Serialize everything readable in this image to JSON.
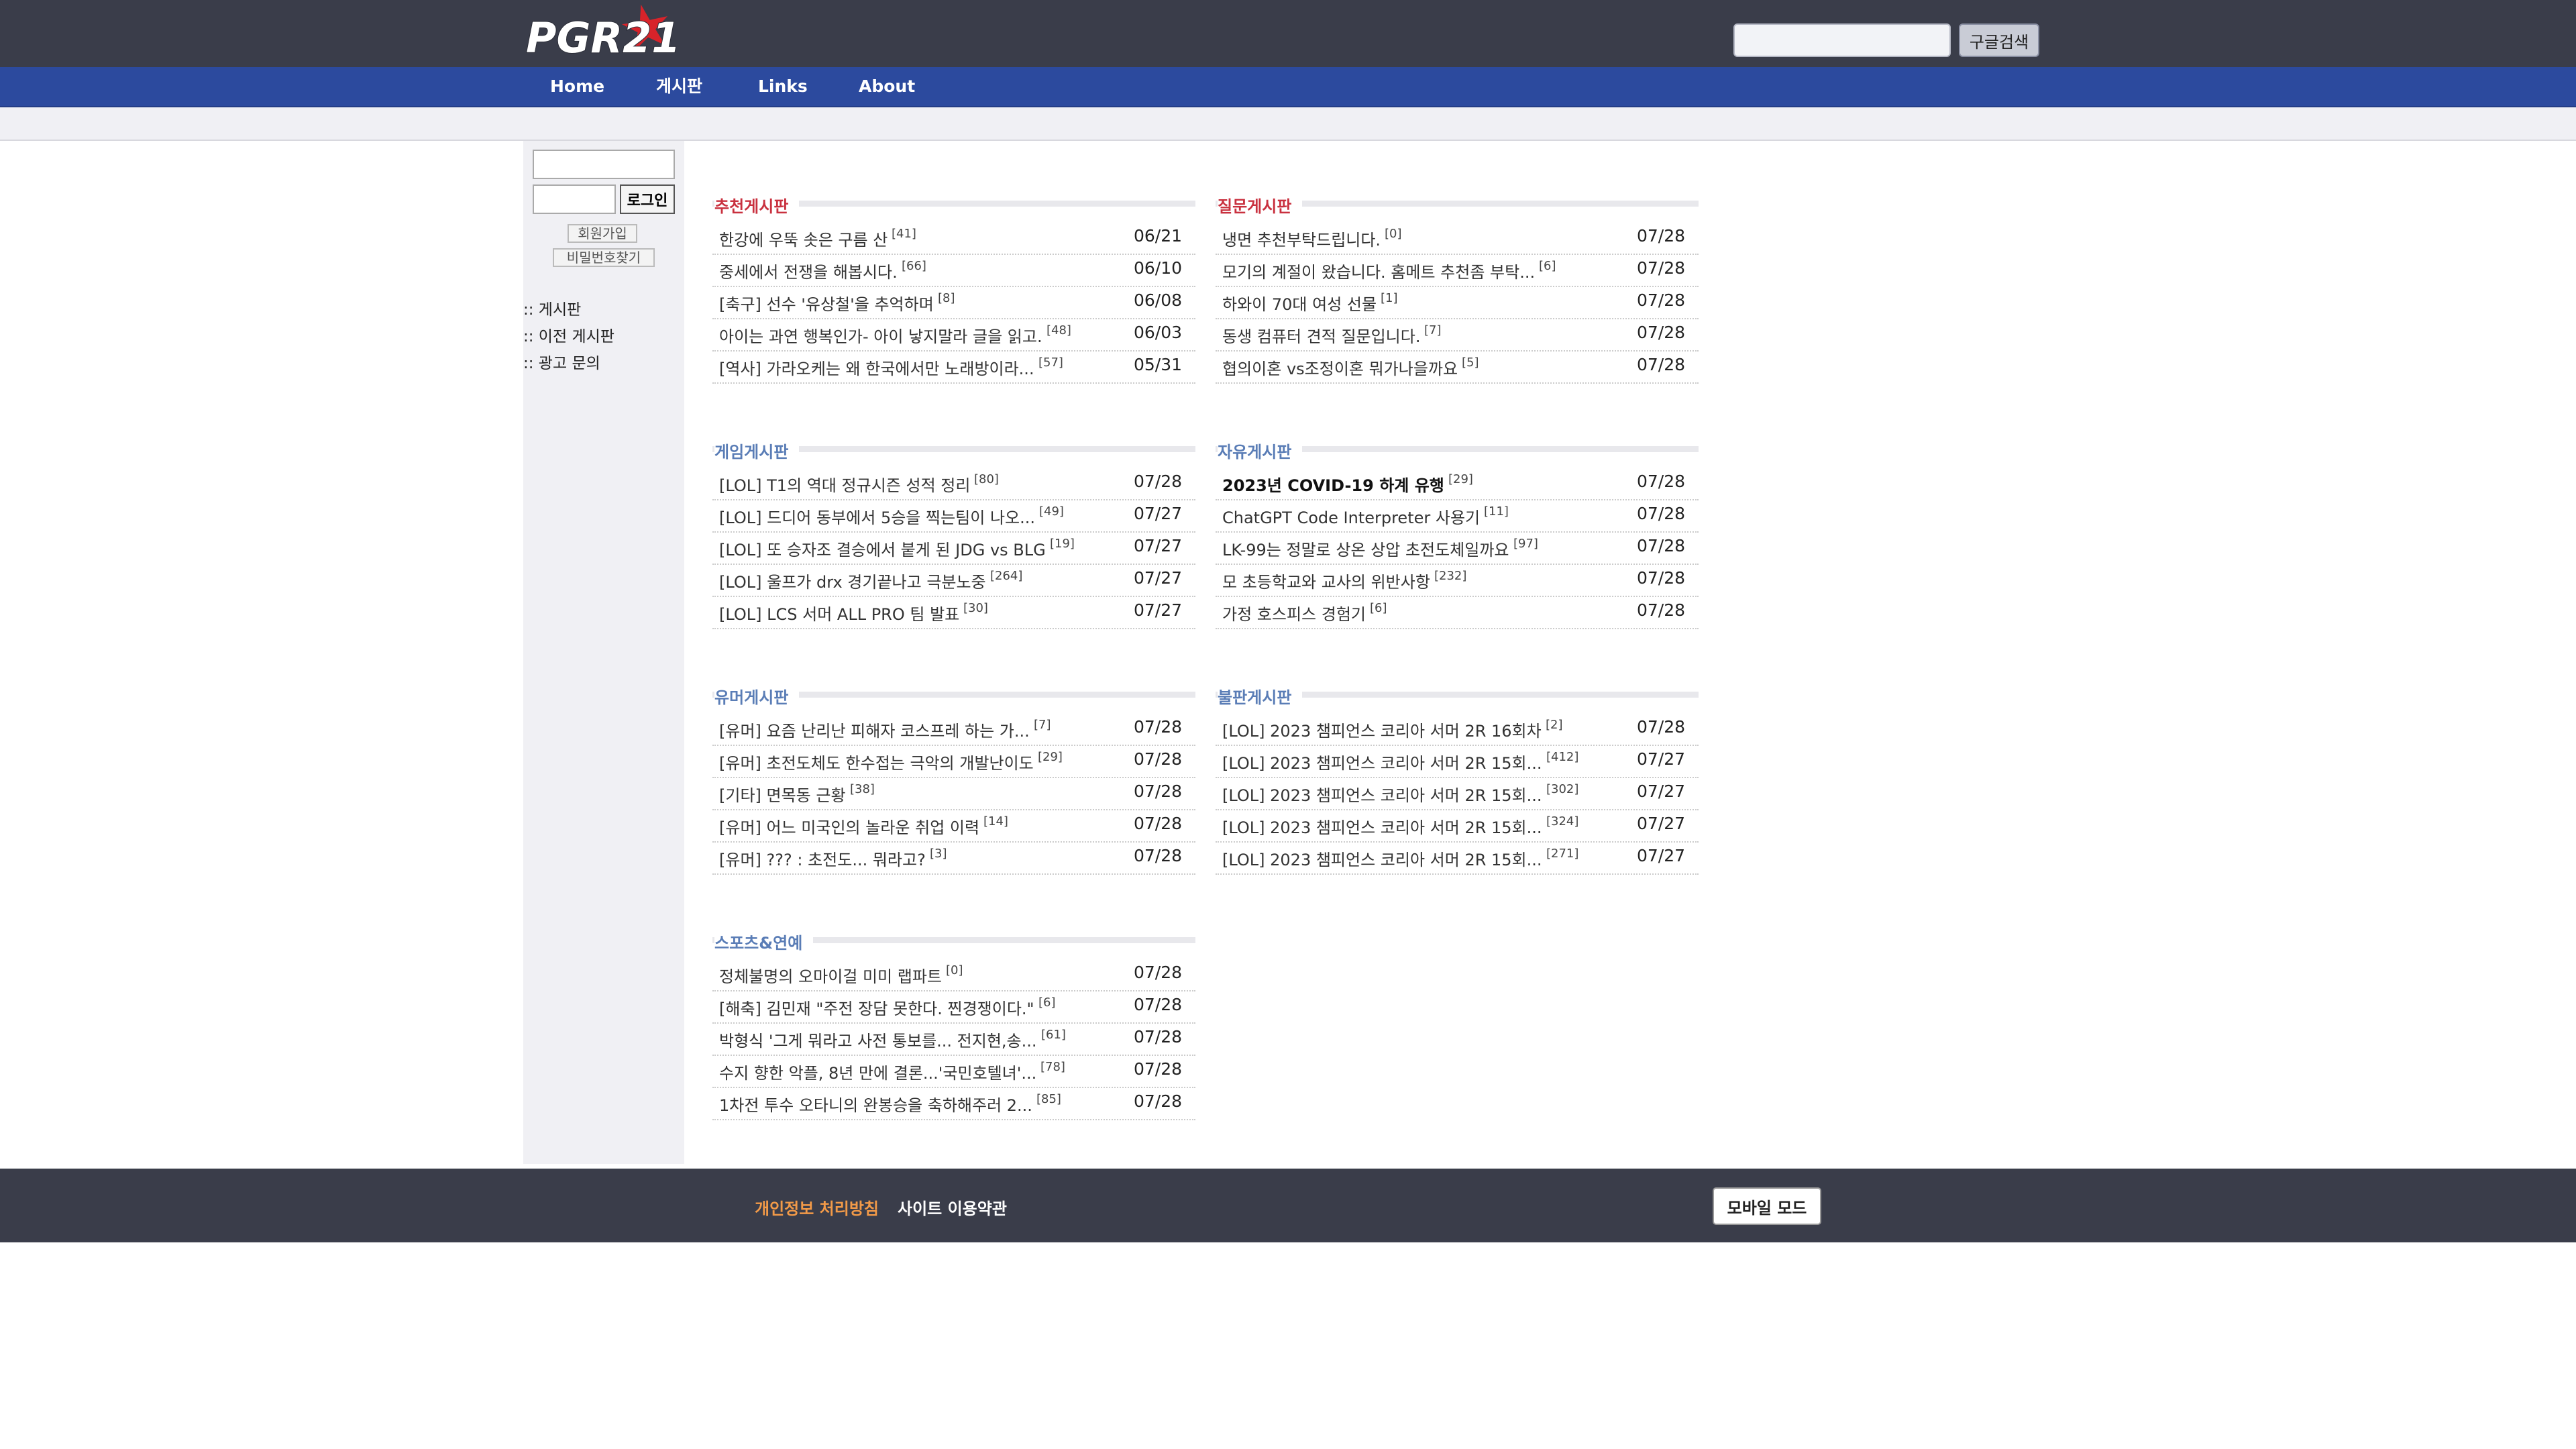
{
  "header": {
    "logo_text": "PGR21",
    "search_placeholder": "",
    "search_button": "구글검색"
  },
  "nav": {
    "items": [
      {
        "label": "Home"
      },
      {
        "label": "게시판"
      },
      {
        "label": "Links"
      },
      {
        "label": "About"
      }
    ]
  },
  "sidebar": {
    "login_button": "로그인",
    "signup_button": "회원가입",
    "find_password_button": "비밀번호찾기",
    "links": [
      {
        "label": ":: 게시판"
      },
      {
        "label": ":: 이전 게시판"
      },
      {
        "label": ":: 광고 문의"
      }
    ]
  },
  "boards": [
    {
      "title": "추천게시판",
      "title_color": "#c9313f",
      "posts": [
        {
          "title": "한강에 우뚝 솟은 구름 산",
          "count": "[41]",
          "date": "06/21"
        },
        {
          "title": "중세에서 전쟁을 해봅시다.",
          "count": "[66]",
          "date": "06/10"
        },
        {
          "title": "[축구] 선수 '유상철'을 추억하며",
          "count": "[8]",
          "date": "06/08"
        },
        {
          "title": "아이는 과연 행복인가- 아이 낳지말라 글을 읽고.",
          "count": "[48]",
          "date": "06/03"
        },
        {
          "title": "[역사] 가라오케는 왜 한국에서만 노래방이라...",
          "count": "[57]",
          "date": "05/31"
        }
      ]
    },
    {
      "title": "질문게시판",
      "title_color": "#c9313f",
      "posts": [
        {
          "title": "냉면 추천부탁드립니다.",
          "count": "[0]",
          "date": "07/28"
        },
        {
          "title": "모기의 계절이 왔습니다. 홈메트 추천좀 부탁...",
          "count": "[6]",
          "date": "07/28"
        },
        {
          "title": "하와이 70대 여성 선물",
          "count": "[1]",
          "date": "07/28"
        },
        {
          "title": "동생 컴퓨터 견적 질문입니다.",
          "count": "[7]",
          "date": "07/28"
        },
        {
          "title": "협의이혼 vs조정이혼 뭐가나을까요",
          "count": "[5]",
          "date": "07/28"
        }
      ]
    },
    {
      "title": "게임게시판",
      "title_color": "#5a7db6",
      "posts": [
        {
          "title": "[LOL] T1의 역대 정규시즌 성적 정리",
          "count": "[80]",
          "date": "07/28"
        },
        {
          "title": "[LOL] 드디어 동부에서 5승을 찍는팀이 나오...",
          "count": "[49]",
          "date": "07/27"
        },
        {
          "title": "[LOL] 또 승자조 결승에서 붙게 된 JDG vs BLG",
          "count": "[19]",
          "date": "07/27"
        },
        {
          "title": "[LOL] 울프가 drx 경기끝나고 극분노중",
          "count": "[264]",
          "date": "07/27"
        },
        {
          "title": "[LOL] LCS 서머 ALL PRO 팀 발표",
          "count": "[30]",
          "date": "07/27"
        }
      ]
    },
    {
      "title": "자유게시판",
      "title_color": "#5a7db6",
      "posts": [
        {
          "title": "2023년 COVID-19 하계 유행",
          "count": "[29]",
          "date": "07/28",
          "bold": true
        },
        {
          "title": "ChatGPT Code Interpreter 사용기",
          "count": "[11]",
          "date": "07/28"
        },
        {
          "title": "LK-99는 정말로 상온 상압 초전도체일까요",
          "count": "[97]",
          "date": "07/28"
        },
        {
          "title": "모 초등학교와 교사의 위반사항",
          "count": "[232]",
          "date": "07/28"
        },
        {
          "title": "가정 호스피스 경험기",
          "count": "[6]",
          "date": "07/28"
        }
      ]
    },
    {
      "title": "유머게시판",
      "title_color": "#5a7db6",
      "posts": [
        {
          "title": "[유머] 요즘 난리난 피해자 코스프레 하는 가...",
          "count": "[7]",
          "date": "07/28"
        },
        {
          "title": "[유머] 초전도체도 한수접는 극악의 개발난이도",
          "count": "[29]",
          "date": "07/28"
        },
        {
          "title": "[기타] 면목동 근황",
          "count": "[38]",
          "date": "07/28"
        },
        {
          "title": "[유머] 어느 미국인의 놀라운 취업 이력",
          "count": "[14]",
          "date": "07/28"
        },
        {
          "title": "[유머] ??? : 초전도... 뭐라고?",
          "count": "[3]",
          "date": "07/28"
        }
      ]
    },
    {
      "title": "불판게시판",
      "title_color": "#5a7db6",
      "posts": [
        {
          "title": "[LOL] 2023 챔피언스 코리아 서머 2R 16회차",
          "count": "[2]",
          "date": "07/28"
        },
        {
          "title": "[LOL] 2023 챔피언스 코리아 서머 2R 15회...",
          "count": "[412]",
          "date": "07/27"
        },
        {
          "title": "[LOL] 2023 챔피언스 코리아 서머 2R 15회...",
          "count": "[302]",
          "date": "07/27"
        },
        {
          "title": "[LOL] 2023 챔피언스 코리아 서머 2R 15회...",
          "count": "[324]",
          "date": "07/27"
        },
        {
          "title": "[LOL] 2023 챔피언스 코리아 서머 2R 15회...",
          "count": "[271]",
          "date": "07/27"
        }
      ]
    },
    {
      "title": "스포츠&연예",
      "title_color": "#5a7db6",
      "posts": [
        {
          "title": "정체불명의 오마이걸 미미 랩파트",
          "count": "[0]",
          "date": "07/28"
        },
        {
          "title": "[해축] 김민재 \"주전 장담 못한다. 찐경쟁이다.\"",
          "count": "[6]",
          "date": "07/28"
        },
        {
          "title": "박형식 '그게 뭐라고 사전 통보를... 전지현,송...",
          "count": "[61]",
          "date": "07/28"
        },
        {
          "title": "수지 향한 악플, 8년 만에 결론...'국민호텔녀'...",
          "count": "[78]",
          "date": "07/28"
        },
        {
          "title": "1차전 투수 오타니의 완봉승을 축하해주러 2...",
          "count": "[85]",
          "date": "07/28"
        }
      ]
    }
  ],
  "footer": {
    "privacy_label": "개인정보 처리방침",
    "terms_label": "사이트 이용약관",
    "mobile_mode_label": "모바일 모드"
  }
}
